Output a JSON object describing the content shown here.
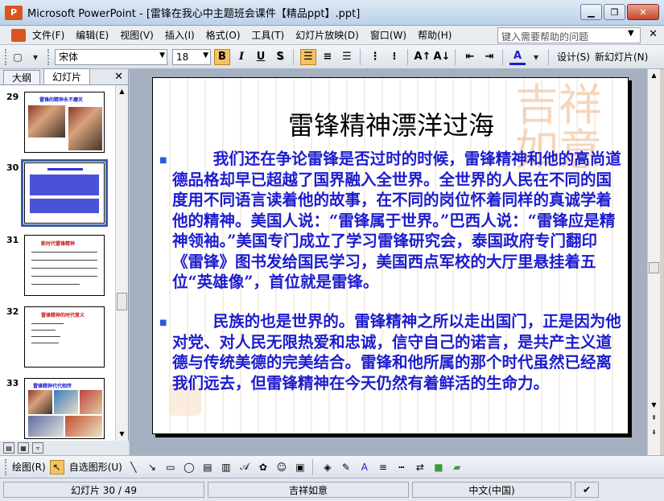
{
  "window": {
    "title": "Microsoft PowerPoint - [雷锋在我心中主题班会课件【精品ppt】.ppt]"
  },
  "menu": {
    "items": [
      "文件(F)",
      "编辑(E)",
      "视图(V)",
      "插入(I)",
      "格式(O)",
      "工具(T)",
      "幻灯片放映(D)",
      "窗口(W)",
      "帮助(H)"
    ],
    "help_placeholder": "键入需要帮助的问题"
  },
  "toolbar": {
    "font": "宋体",
    "font_size": "18",
    "bold": "B",
    "italic": "I",
    "underline": "U",
    "shadow": "S",
    "design": "设计(S)",
    "new_slide": "新幻灯片(N)"
  },
  "pane": {
    "tabs": [
      "大纲",
      "幻灯片"
    ],
    "slides": [
      {
        "num": "29",
        "title": "雷锋的精神永不磨灭"
      },
      {
        "num": "30",
        "selected": true
      },
      {
        "num": "31",
        "title": "新时代雷锋精神"
      },
      {
        "num": "32",
        "title": "雷锋精神的时代意义"
      },
      {
        "num": "33",
        "title": "雷锋精神代代相传"
      }
    ]
  },
  "slide": {
    "title": "雷锋精神漂洋过海",
    "bullets": [
      "我们还在争论雷锋是否过时的时候，雷锋精神和他的高尚道德品格却早已超越了国界融入全世界。全世界的人民在不同的国度用不同语言读着他的故事，在不同的岗位怀着同样的真诚学着他的精神。美国人说：“雷锋属于世界。”巴西人说：“雷锋应是精神领袖。”美国专门成立了学习雷锋研究会，泰国政府专门翻印《雷锋》图书发给国民学习，美国西点军校的大厅里悬挂着五位“英雄像”，首位就是雷锋。",
      "民族的也是世界的。雷锋精神之所以走出国门，正是因为他对党、对人民无限热爱和忠诚，信守自己的诺言，是共产主义道德与传统美德的完美结合。雷锋和他所属的那个时代虽然已经离我们远去，但雷锋精神在今天仍然有着鲜活的生命力。"
    ],
    "deco_text": "吉祥如意"
  },
  "drawing": {
    "draw": "绘图(R)",
    "autoshape": "自选图形(U)"
  },
  "status": {
    "slide": "幻灯片 30 / 49",
    "design": "吉祥如意",
    "lang": "中文(中国)"
  }
}
